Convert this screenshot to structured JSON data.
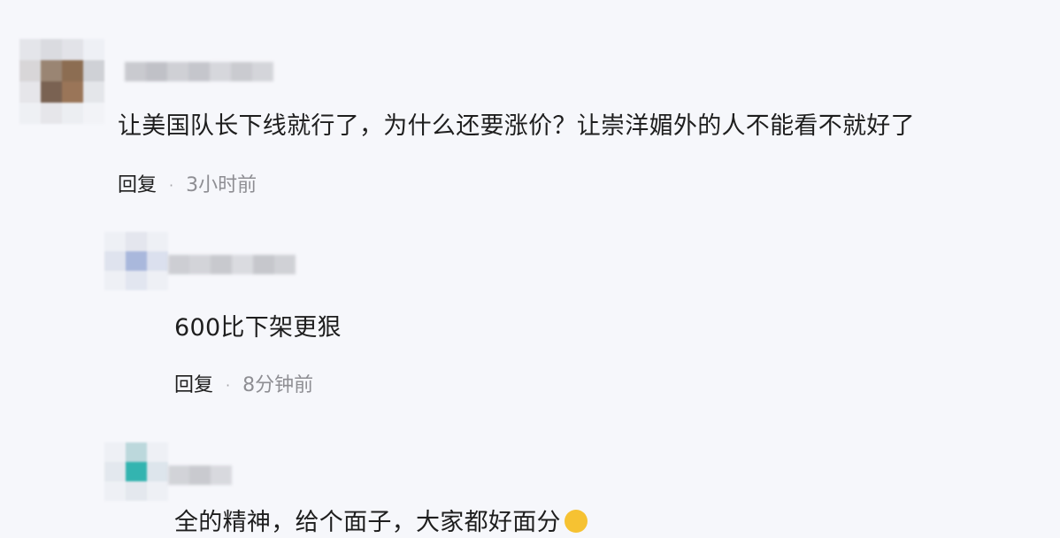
{
  "comments": [
    {
      "text": "让美国队长下线就行了，为什么还要涨价？让崇洋媚外的人不能看不就好了",
      "reply_label": "回复",
      "separator": "·",
      "time": "3小时前"
    },
    {
      "text": "600比下架更狠",
      "reply_label": "回复",
      "separator": "·",
      "time": "8分钟前"
    },
    {
      "text": "全的精神，给个面子，大家都好面分"
    }
  ],
  "colors": {
    "background": "#f6f7fb",
    "text": "#1e1e1e",
    "meta": "#8e8e93"
  }
}
